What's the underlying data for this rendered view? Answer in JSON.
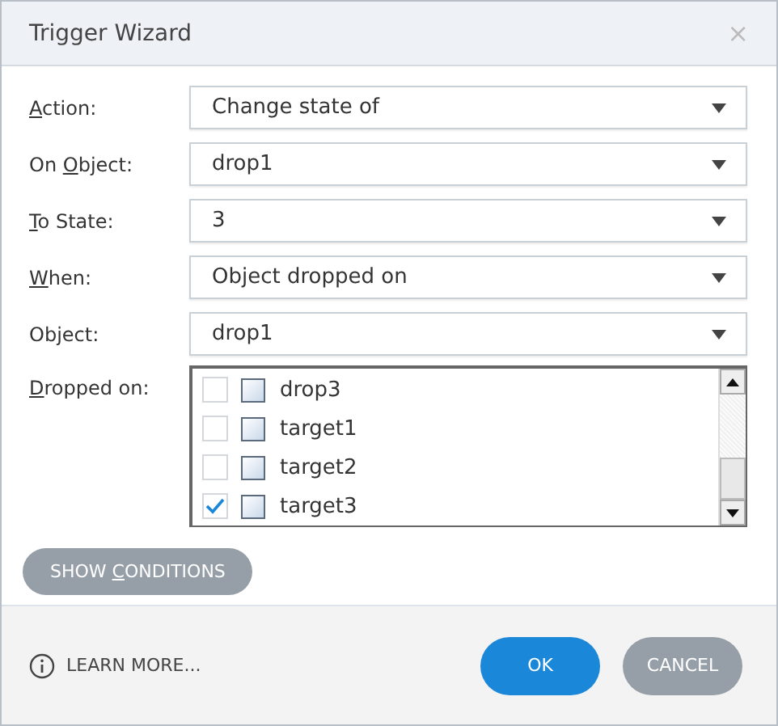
{
  "window": {
    "title": "Trigger Wizard",
    "close": "×"
  },
  "fields": [
    {
      "label_key": "A",
      "label_after": "ction:",
      "value": "Change state of"
    },
    {
      "label_before": "On ",
      "label_key": "O",
      "label_after": "bject:",
      "value": "drop1"
    },
    {
      "label_key": "T",
      "label_after": "o State:",
      "value": "3"
    },
    {
      "label_key": "W",
      "label_after": "hen:",
      "value": "Object dropped on"
    },
    {
      "label_before": "Object:",
      "value": "drop1"
    }
  ],
  "dropped_on": {
    "label_key": "D",
    "label_after": "ropped on:",
    "items": [
      {
        "name": "drop3",
        "checked": false
      },
      {
        "name": "target1",
        "checked": false
      },
      {
        "name": "target2",
        "checked": false
      },
      {
        "name": "target3",
        "checked": true
      }
    ]
  },
  "show_conditions": {
    "label_before": "SHOW ",
    "label_key": "C",
    "label_after": "ONDITIONS"
  },
  "footer": {
    "learn_more": "LEARN MORE...",
    "ok": "OK",
    "cancel": "CANCEL"
  }
}
